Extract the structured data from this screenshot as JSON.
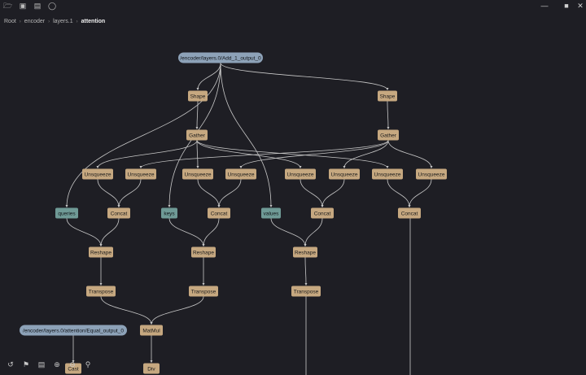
{
  "window": {
    "title": "",
    "icons": [
      "folder-open-icon",
      "save-icon",
      "image-icon",
      "user-search-icon"
    ],
    "controls": [
      "minimize-icon",
      "maximize-icon",
      "close-icon"
    ]
  },
  "breadcrumb": [
    "Root",
    "encoder",
    "layers.1",
    "attention"
  ],
  "graph": {
    "colors": {
      "op": "#c6a880",
      "io_blue": "#8da2b8",
      "io_teal": "#6f9a96",
      "edge": "#c8c8c8"
    },
    "nodes": [
      {
        "id": "add",
        "label": "/encoder/layers.0/Add_1_output_0",
        "kind": "io_blue"
      },
      {
        "id": "shape1",
        "label": "Shape",
        "kind": "op"
      },
      {
        "id": "shape2",
        "label": "Shape",
        "kind": "op"
      },
      {
        "id": "gather1",
        "label": "Gather",
        "kind": "op"
      },
      {
        "id": "gather2",
        "label": "Gather",
        "kind": "op"
      },
      {
        "id": "unsq1",
        "label": "Unsqueeze",
        "kind": "op"
      },
      {
        "id": "unsq2",
        "label": "Unsqueeze",
        "kind": "op"
      },
      {
        "id": "unsq3",
        "label": "Unsqueeze",
        "kind": "op"
      },
      {
        "id": "unsq4",
        "label": "Unsqueeze",
        "kind": "op"
      },
      {
        "id": "unsq5",
        "label": "Unsqueeze",
        "kind": "op"
      },
      {
        "id": "unsq6",
        "label": "Unsqueeze",
        "kind": "op"
      },
      {
        "id": "unsq7",
        "label": "Unsqueeze",
        "kind": "op"
      },
      {
        "id": "unsq8",
        "label": "Unsqueeze",
        "kind": "op"
      },
      {
        "id": "queries",
        "label": "queries",
        "kind": "io_teal"
      },
      {
        "id": "concat1",
        "label": "Concat",
        "kind": "op"
      },
      {
        "id": "keys",
        "label": "keys",
        "kind": "io_teal"
      },
      {
        "id": "concat2",
        "label": "Concat",
        "kind": "op"
      },
      {
        "id": "values",
        "label": "values",
        "kind": "io_teal"
      },
      {
        "id": "concat3",
        "label": "Concat",
        "kind": "op"
      },
      {
        "id": "concat4",
        "label": "Concat",
        "kind": "op"
      },
      {
        "id": "reshape1",
        "label": "Reshape",
        "kind": "op"
      },
      {
        "id": "reshape2",
        "label": "Reshape",
        "kind": "op"
      },
      {
        "id": "reshape3",
        "label": "Reshape",
        "kind": "op"
      },
      {
        "id": "transpose1",
        "label": "Transpose",
        "kind": "op"
      },
      {
        "id": "transpose2",
        "label": "Transpose",
        "kind": "op"
      },
      {
        "id": "transpose3",
        "label": "Transpose",
        "kind": "op"
      },
      {
        "id": "equal",
        "label": "/encoder/layers.0/attention/Equal_output_0",
        "kind": "io_blue"
      },
      {
        "id": "matmul",
        "label": "MatMul",
        "kind": "op"
      },
      {
        "id": "cast",
        "label": "Cast",
        "kind": "op"
      },
      {
        "id": "div",
        "label": "Div",
        "kind": "op"
      }
    ],
    "edges": [
      [
        "add",
        "shape1"
      ],
      [
        "add",
        "shape2"
      ],
      [
        "add",
        "queries"
      ],
      [
        "add",
        "keys"
      ],
      [
        "add",
        "values"
      ],
      [
        "shape1",
        "gather1"
      ],
      [
        "shape2",
        "gather2"
      ],
      [
        "gather1",
        "unsq1"
      ],
      [
        "gather1",
        "unsq3"
      ],
      [
        "gather1",
        "unsq5"
      ],
      [
        "gather1",
        "unsq7"
      ],
      [
        "gather2",
        "unsq2"
      ],
      [
        "gather2",
        "unsq4"
      ],
      [
        "gather2",
        "unsq6"
      ],
      [
        "gather2",
        "unsq8"
      ],
      [
        "unsq1",
        "concat1"
      ],
      [
        "unsq2",
        "concat1"
      ],
      [
        "unsq3",
        "concat2"
      ],
      [
        "unsq4",
        "concat2"
      ],
      [
        "unsq5",
        "concat3"
      ],
      [
        "unsq6",
        "concat3"
      ],
      [
        "unsq7",
        "concat4"
      ],
      [
        "unsq8",
        "concat4"
      ],
      [
        "queries",
        "reshape1"
      ],
      [
        "concat1",
        "reshape1"
      ],
      [
        "keys",
        "reshape2"
      ],
      [
        "concat2",
        "reshape2"
      ],
      [
        "values",
        "reshape3"
      ],
      [
        "concat3",
        "reshape3"
      ],
      [
        "reshape1",
        "transpose1"
      ],
      [
        "reshape2",
        "transpose2"
      ],
      [
        "reshape3",
        "transpose3"
      ],
      [
        "transpose1",
        "matmul"
      ],
      [
        "transpose2",
        "matmul"
      ],
      [
        "equal",
        "cast"
      ],
      [
        "matmul",
        "div"
      ]
    ]
  },
  "toolbar": [
    "history-icon",
    "flag-icon",
    "list-icon",
    "zoom-in-icon",
    "zoom-out-icon",
    "search-icon"
  ]
}
